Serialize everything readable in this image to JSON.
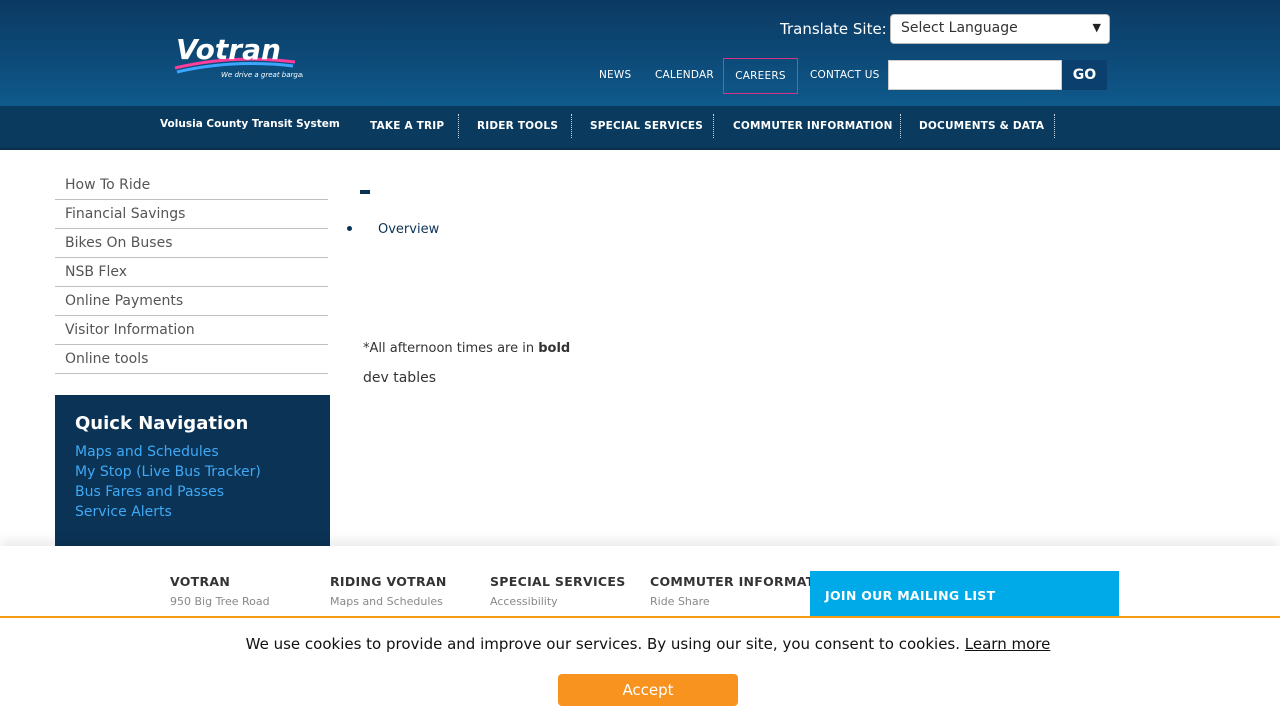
{
  "header": {
    "logo_text": "Votran",
    "logo_tagline": "We drive a great bargain",
    "translate_label": "Translate Site:",
    "language_select": "Select Language",
    "top_links": [
      "NEWS",
      "CALENDAR",
      "CAREERS",
      "CONTACT US"
    ],
    "search_value": "",
    "go_label": "GO"
  },
  "nav": {
    "site_name": "Volusia County Transit System",
    "items": [
      "TAKE A TRIP",
      "RIDER TOOLS",
      "SPECIAL SERVICES",
      "COMMUTER INFORMATION",
      "DOCUMENTS & DATA"
    ]
  },
  "sidebar": {
    "items": [
      "How To Ride",
      "Financial Savings",
      "Bikes On Buses",
      "NSB Flex",
      "Online Payments",
      "Visitor Information",
      "Online tools"
    ]
  },
  "quick_nav": {
    "title": "Quick Navigation",
    "links": [
      "Maps and Schedules",
      "My Stop (Live Bus Tracker)",
      "Bus Fares and Passes",
      "Service Alerts"
    ]
  },
  "content": {
    "overview": "Overview",
    "note_prefix": "*All afternoon times are in ",
    "note_bold": "bold",
    "dev_tables": "dev tables"
  },
  "footer": {
    "columns": [
      {
        "title": "VOTRAN",
        "line": "950 Big Tree Road"
      },
      {
        "title": "RIDING VOTRAN",
        "line": "Maps and Schedules"
      },
      {
        "title": "SPECIAL SERVICES",
        "line": "Accessibility"
      },
      {
        "title": "COMMUTER INFORMATION",
        "line": "Ride Share"
      }
    ],
    "mailing": "JOIN OUR MAILING LIST"
  },
  "cookie": {
    "text": "We use cookies to provide and improve our services. By using our site, you consent to cookies.",
    "learn_more": "Learn more",
    "accept": "Accept"
  },
  "colors": {
    "header": "#0d4a78",
    "nav": "#0a3a5e",
    "quick_nav": "#0b3356",
    "link_blue": "#3fa9f5",
    "mailing": "#00a9e8",
    "accept": "#f7931e"
  }
}
